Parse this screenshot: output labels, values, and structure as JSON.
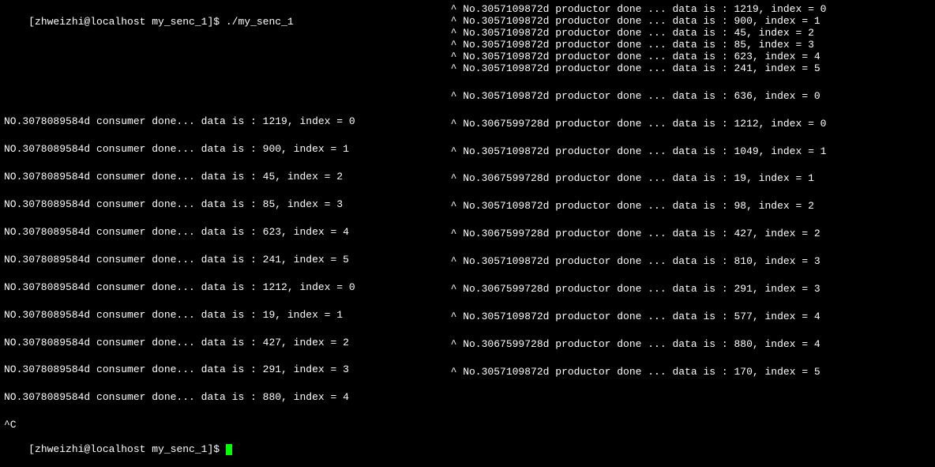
{
  "left": {
    "prompt1": "[zhweizhi@localhost my_senc_1]$ ",
    "command": "./my_senc_1",
    "lines": [
      "NO.3078089584d consumer done... data is : 1219, index = 0",
      "NO.3078089584d consumer done... data is : 900, index = 1",
      "NO.3078089584d consumer done... data is : 45, index = 2",
      "NO.3078089584d consumer done... data is : 85, index = 3",
      "NO.3078089584d consumer done... data is : 623, index = 4",
      "NO.3078089584d consumer done... data is : 241, index = 5",
      "NO.3078089584d consumer done... data is : 1212, index = 0",
      "NO.3078089584d consumer done... data is : 19, index = 1",
      "NO.3078089584d consumer done... data is : 427, index = 2",
      "NO.3078089584d consumer done... data is : 291, index = 3",
      "NO.3078089584d consumer done... data is : 880, index = 4"
    ],
    "interrupt": "^C",
    "prompt2": "[zhweizhi@localhost my_senc_1]$ "
  },
  "right": {
    "tight_lines": [
      "  ^ No.3057109872d productor done ... data is : 1219, index = 0",
      "  ^ No.3057109872d productor done ... data is : 900, index = 1",
      "  ^ No.3057109872d productor done ... data is : 45, index = 2",
      "  ^ No.3057109872d productor done ... data is : 85, index = 3",
      "  ^ No.3057109872d productor done ... data is : 623, index = 4",
      "  ^ No.3057109872d productor done ... data is : 241, index = 5"
    ],
    "lines": [
      "  ^ No.3057109872d productor done ... data is : 636, index = 0",
      "  ^ No.3067599728d productor done ... data is : 1212, index = 0",
      "  ^ No.3057109872d productor done ... data is : 1049, index = 1",
      "  ^ No.3067599728d productor done ... data is : 19, index = 1",
      "  ^ No.3057109872d productor done ... data is : 98, index = 2",
      "  ^ No.3067599728d productor done ... data is : 427, index = 2",
      "  ^ No.3057109872d productor done ... data is : 810, index = 3",
      "  ^ No.3067599728d productor done ... data is : 291, index = 3",
      "  ^ No.3057109872d productor done ... data is : 577, index = 4",
      "  ^ No.3067599728d productor done ... data is : 880, index = 4",
      "  ^ No.3057109872d productor done ... data is : 170, index = 5"
    ]
  }
}
